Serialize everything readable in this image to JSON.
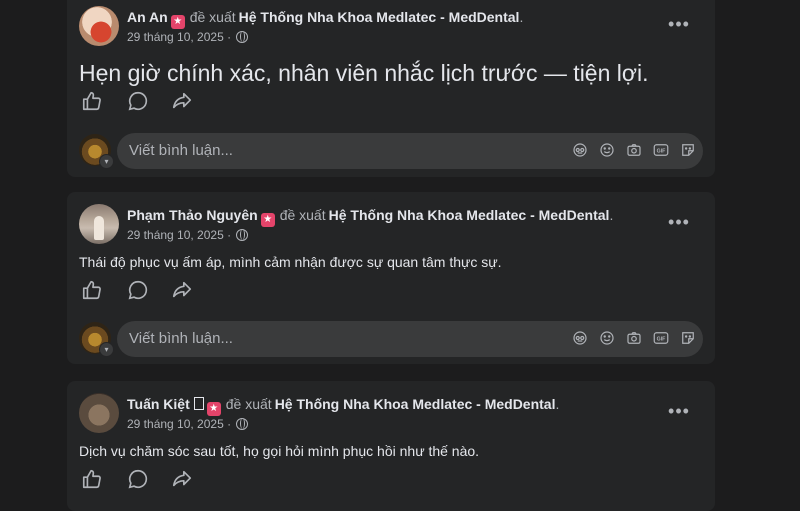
{
  "posts": [
    {
      "author": "An An",
      "verb": "đề xuất",
      "page": "Hệ Thống Nha Khoa Medlatec - MedDental",
      "period": ".",
      "date": "29 tháng 10, 2025",
      "sep": "·",
      "text": "Hẹn giờ chính xác, nhân viên nhắc lịch trước — tiện lợi."
    },
    {
      "author": "Phạm Thảo Nguyên",
      "verb": "đề xuất",
      "page": "Hệ Thống Nha Khoa Medlatec - MedDental",
      "period": ".",
      "date": "29 tháng 10, 2025",
      "sep": "·",
      "text": "Thái độ phục vụ ấm áp, mình cảm nhận được sự quan tâm thực sự."
    },
    {
      "author": "Tuấn Kiệt",
      "verb": "đề xuất",
      "page": "Hệ Thống Nha Khoa Medlatec - MedDental",
      "period": ".",
      "date": "29 tháng 10, 2025",
      "sep": "·",
      "text": "Dịch vụ chăm sóc sau tốt, họ gọi hỏi mình phục hồi như thế nào."
    }
  ],
  "comment": {
    "placeholder": "Viết bình luận..."
  },
  "more_label": "•••",
  "badge_glyph": "★",
  "icons": [
    "like-icon",
    "comment-icon",
    "share-icon",
    "globe-icon",
    "avatar-sticker-icon",
    "emoji-icon",
    "camera-icon",
    "gif-icon",
    "sticker-icon"
  ],
  "colors": {
    "background": "#1c1c1d",
    "card": "#242526",
    "input": "#3a3b3c",
    "text": "#e4e6eb",
    "secondary": "#b0b3b8",
    "badge": "#e4446a"
  }
}
